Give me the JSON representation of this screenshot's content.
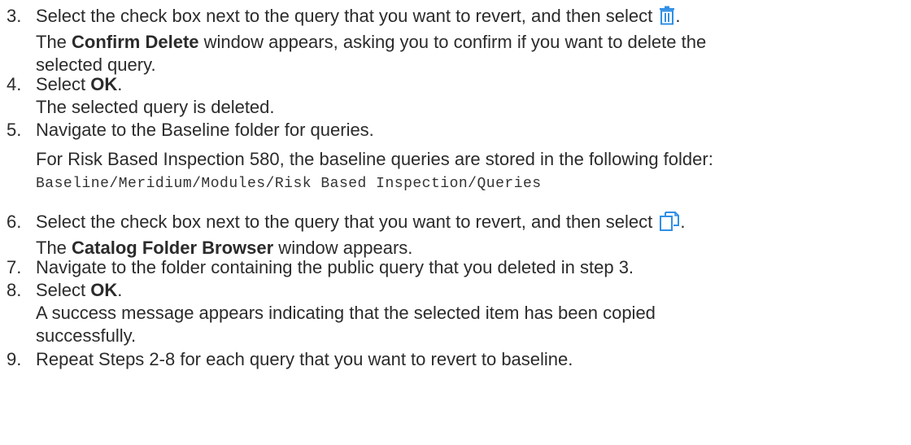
{
  "steps": [
    {
      "number": "3.",
      "lines": [
        {
          "pre": "Select the check box next to the query that you want to revert, and then select ",
          "icon": "trash-icon",
          "post": "."
        },
        {
          "pre": "The ",
          "bold": "Confirm Delete",
          "post": " window appears, asking you to confirm if you want to delete the"
        },
        {
          "pre": "selected query."
        }
      ]
    },
    {
      "number": "4.",
      "lines": [
        {
          "pre": "Select ",
          "bold": "OK",
          "post": "."
        },
        {
          "pre": "The selected query is deleted."
        }
      ]
    },
    {
      "number": "5.",
      "lines": [
        {
          "pre": "Navigate to the Baseline folder for queries."
        },
        {
          "pre": "For Risk Based Inspection 580, the baseline queries are stored in the following folder:"
        }
      ],
      "code": "Baseline/Meridium/Modules/Risk Based Inspection/Queries"
    },
    {
      "number": "6.",
      "lines": [
        {
          "pre": "Select the check box next to the query that you want to revert, and then select ",
          "icon": "copy-icon",
          "post": "."
        },
        {
          "pre": "The ",
          "bold": "Catalog Folder Browser",
          "post": " window appears."
        }
      ]
    },
    {
      "number": "7.",
      "lines": [
        {
          "pre": "Navigate to the folder containing the public query that you deleted in step 3."
        }
      ]
    },
    {
      "number": "8.",
      "lines": [
        {
          "pre": "Select ",
          "bold": "OK",
          "post": "."
        },
        {
          "pre": "A success message appears indicating that the selected item has been copied"
        },
        {
          "pre": "successfully."
        }
      ]
    },
    {
      "number": "9.",
      "lines": [
        {
          "pre": "Repeat Steps 2-8 for each query that you want to revert to baseline."
        }
      ]
    }
  ],
  "colors": {
    "text": "#2b2b2b",
    "icon_blue": "#2f8fe6"
  }
}
